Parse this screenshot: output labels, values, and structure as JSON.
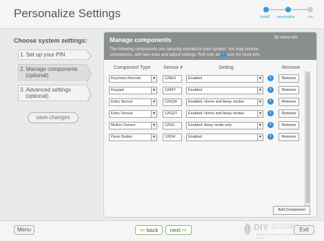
{
  "header": {
    "title": "Personalize Settings",
    "progress_steps": [
      {
        "label": "install",
        "done": true
      },
      {
        "label": "personalize",
        "done": true
      },
      {
        "label": "use",
        "done": false
      }
    ]
  },
  "sidebar": {
    "heading": "Choose system settings:",
    "steps": [
      {
        "line1": "1. Set up your PIN",
        "line2": ""
      },
      {
        "line1": "2. Manage components",
        "line2": "(optional)"
      },
      {
        "line1": "3. Advanced settings",
        "line2": "(optional)"
      }
    ],
    "save_label": "save changes"
  },
  "panel": {
    "title": "Manage components",
    "more_info": "for more info",
    "desc_1": "The following components are currently enrolled in your system. You may remove",
    "desc_2": "components, add new ones and adjust settings. Roll over an",
    "desc_icon": "i",
    "desc_3": "icon for more info.",
    "columns": {
      "type": "Component Type",
      "sensor": "Sensor #",
      "setting": "Setting",
      "remove": "Remove"
    },
    "rows": [
      {
        "type": "Keychain Remote",
        "sensor": "126E9",
        "setting": "Enabled"
      },
      {
        "type": "Keypad",
        "sensor": "1284Y",
        "setting": "Enabled"
      },
      {
        "type": "Entry Sensor",
        "sensor": "12GQ4",
        "setting": "Enabled: Home and Away modes"
      },
      {
        "type": "Entry Sensor",
        "sensor": "12GQT",
        "setting": "Enabled: Home and Away modes"
      },
      {
        "type": "Motion Sensor",
        "sensor": "125ZL",
        "setting": "Enabled: Away mode only"
      },
      {
        "type": "Panic Button",
        "sensor": "12634",
        "setting": "Enabled"
      }
    ],
    "remove_label": "Remove",
    "info_glyph": "i",
    "caret_glyph": "▼",
    "add_label": "Add Component"
  },
  "footer": {
    "menu": "Menu",
    "back": "back",
    "next": "next",
    "exit": "Exit",
    "back_arrow": "⇦",
    "next_arrow": "⇨"
  },
  "watermark": {
    "brand_a": "DIY",
    "brand_b": "GUIDES",
    "tagline": "HOME IMPROVEMENT MADE EASY"
  },
  "colors": {
    "accent": "#2a9fd6",
    "panel_header": "#8a8e8c",
    "info_icon": "#3a8fd4",
    "nav_arrow": "#5fae3a"
  }
}
